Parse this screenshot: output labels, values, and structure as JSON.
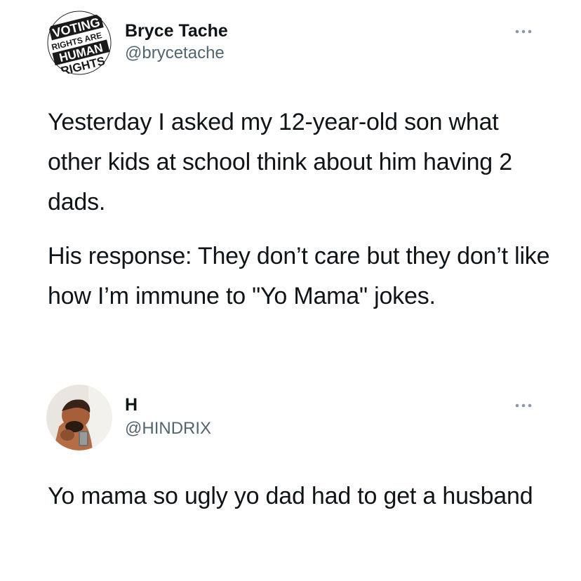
{
  "tweets": [
    {
      "display_name": "Bryce Tache",
      "handle": "@brycetache",
      "avatar": {
        "icon": "voting-rights-badge-avatar",
        "lines": [
          "VOTING",
          "RIGHTS ARE",
          "HUMAN",
          "RIGHTS"
        ]
      },
      "paragraphs": [
        "Yesterday I asked my 12-year-old son what other kids at school think about him having 2 dads.",
        "His response: They don’t care but they don’t like how I’m immune to \"Yo Mama\" jokes."
      ]
    },
    {
      "display_name": "H",
      "handle": "@HINDRIX",
      "avatar": {
        "icon": "profile-photo-avatar"
      },
      "paragraphs": [
        "Yo mama so ugly yo dad had to get a husband"
      ]
    }
  ],
  "colors": {
    "text": "#0f1419",
    "secondary": "#536471",
    "background": "#ffffff"
  }
}
